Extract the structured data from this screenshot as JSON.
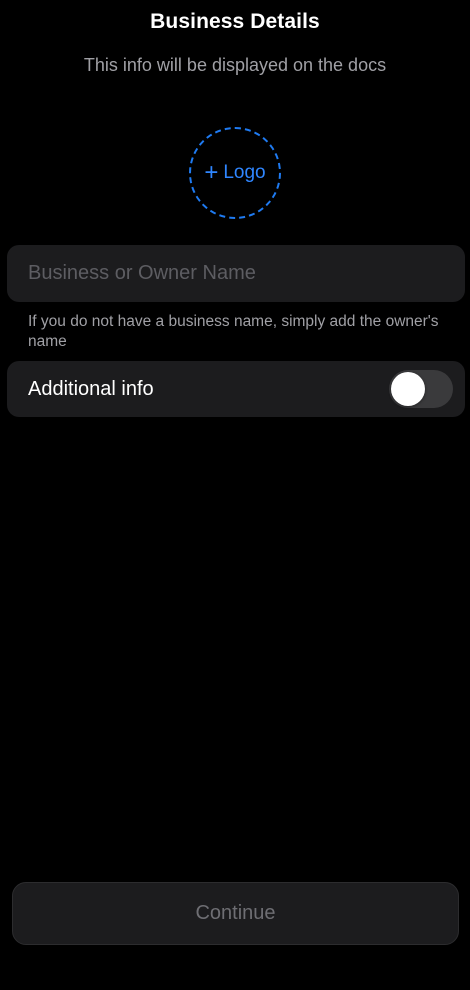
{
  "header": {
    "title": "Business Details",
    "subtitle": "This info will be displayed on the docs"
  },
  "logo": {
    "plus": "+",
    "label": "Logo",
    "accent_color": "#2f86ff"
  },
  "name_field": {
    "value": "",
    "placeholder": "Business or Owner Name",
    "hint": "If you do not have a business name, simply add the owner's name"
  },
  "additional_info": {
    "label": "Additional info",
    "enabled": false
  },
  "footer": {
    "continue_label": "Continue",
    "continue_enabled": false
  }
}
